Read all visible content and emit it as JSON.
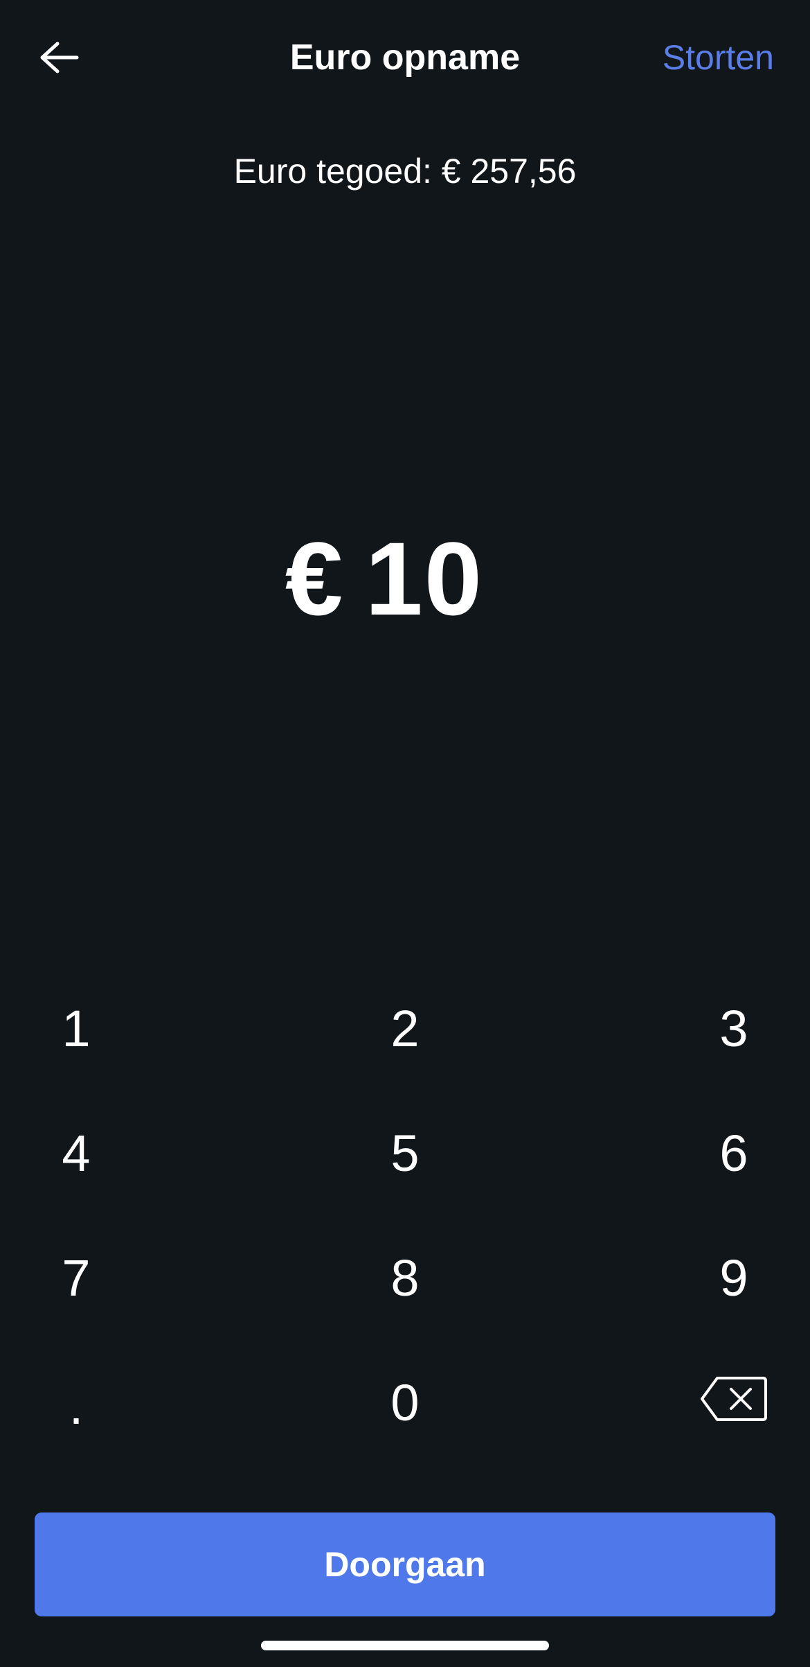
{
  "header": {
    "back_icon": "arrow-left-icon",
    "title": "Euro opname",
    "deposit_label": "Storten"
  },
  "balance": {
    "text": "Euro tegoed: € 257,56"
  },
  "amount": {
    "currency": "€",
    "value": "10"
  },
  "keypad": {
    "keys": [
      "1",
      "2",
      "3",
      "4",
      "5",
      "6",
      "7",
      "8",
      "9",
      ".",
      "0"
    ],
    "backspace_icon": "backspace-icon"
  },
  "footer": {
    "continue_label": "Doorgaan"
  },
  "colors": {
    "background": "#11161b",
    "accent": "#4f79ea",
    "link": "#5b7de8",
    "text": "#ffffff"
  }
}
